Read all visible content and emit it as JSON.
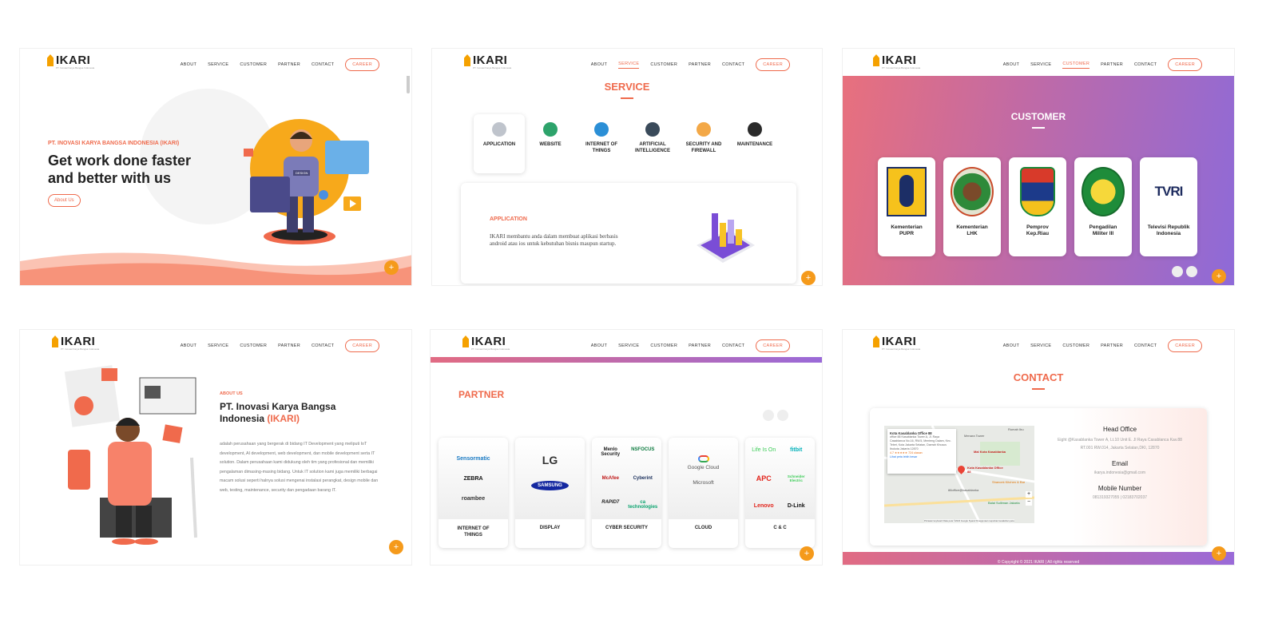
{
  "nav": {
    "logo": "IKARI",
    "logo_sub": "PT. Inovasi Karya Bangsa Indonesia",
    "items": [
      "ABOUT",
      "SERVICE",
      "CUSTOMER",
      "PARTNER",
      "CONTACT"
    ],
    "career": "CAREER"
  },
  "p1": {
    "company": "PT. INOVASI KARYA BANGSA INDONESIA (IKARI)",
    "headline1": "Get work done faster",
    "headline2": "and better with us",
    "button": "About Us",
    "badge": "DESIGN"
  },
  "p2": {
    "title": "SERVICE",
    "services": [
      "APPLICATION",
      "WEBSITE",
      "INTERNET OF THINGS",
      "ARTIFICIAL INTELLIGENCE",
      "SECURITY AND FIREWALL",
      "MAINTENANCE"
    ],
    "detail_title": "APPLICATION",
    "detail_text": "IKARI membantu anda dalam membuat aplikasi berbasis android atau ios untuk kebutuhan bisnis maupun startup."
  },
  "p3": {
    "title": "CUSTOMER",
    "customers": [
      "Kementerian PUPR",
      "Kementerian LHK",
      "Pemprov Kep.Riau",
      "Pengadilan Militer III",
      "Televisi Republik Indonesia"
    ],
    "tvri": "TVRI"
  },
  "p4": {
    "eyebrow": "ABOUT US",
    "title1": "PT. Inovasi Karya Bangsa",
    "title2": "Indonesia",
    "title_hl": "(IKARI)",
    "body": "adalah perusahaan yang bergerak di bidang IT Development yang meliputi IoT development, AI development, web development, dan mobile development serta IT solution. Dalam perusahaan kami didukung oleh tim yang profesional dan memiliki pengalaman dimasing-masing bidang. Untuk IT solution kami juga memiliki berbagai macam solusi seperti halnya solusi mengenai instalasi perangkat, design mobile dan web, testing, maintenance, security dan pengadaan barang IT."
  },
  "p5": {
    "title": "PARTNER",
    "groups": [
      {
        "label": "INTERNET OF THINGS",
        "logos": [
          "Sensormatic",
          "ZEBRA",
          "roambee"
        ]
      },
      {
        "label": "DISPLAY",
        "logos": [
          "LG",
          "SAMSUNG"
        ]
      },
      {
        "label": "CYBER SECURITY",
        "logos": [
          "Menlo Security",
          "NSFOCUS",
          "McAfee",
          "Cyberint",
          "RAPID7",
          "ca technologies"
        ]
      },
      {
        "label": "CLOUD",
        "logos": [
          "Google Cloud",
          "Microsoft"
        ]
      },
      {
        "label": "C & C",
        "logos": [
          "Life Is On",
          "fitbit",
          "APC",
          "Schneider Electric",
          "Lenovo",
          "D-Link"
        ]
      }
    ]
  },
  "p6": {
    "title": "CONTACT",
    "map_place": "Kota Kasablanka Office 88",
    "map_addr": "office 88 Kasablanka Tower A, Jl. Raya Casablanca No.16, RW.5, Menteng Dalam, Kec. Tebet, Kota Jakarta Selatan, Daerah Khusus Ibukota Jakarta 12870",
    "map_rating": "4.7 ★★★★★ 724 ulasan",
    "map_link": "Lihat peta lebih besar",
    "map_labels": [
      "Mal Kota Kasablanka",
      "Kota Kasablanka Office 88",
      "Shancek Kitchen & Bar",
      "Balai Sulliman Jakarta",
      "88office@kasablanka",
      "Menara Tower",
      "Rumah Ibu"
    ],
    "map_footer": "Pintasan keyboard   Data peta ©2022 Google   Syarat Penggunaan   Laporkan kesalahan peta",
    "head_office_label": "Head Office",
    "head_office": "Eight @Kasablanka Tower A, Lt.10 Unit E. Jl Raya Casablanca Kav.88 RT.001 RW.014, Jakarta Selatan,DKI, 12870",
    "email_label": "Email",
    "email": "ikarya.indonesia@gmail.com",
    "mobile_label": "Mobile Number",
    "mobile": "081319327055 | 02183702037",
    "copyright": "© Copyright © 2021 IKARI | All rights reserved"
  },
  "fab": "+"
}
